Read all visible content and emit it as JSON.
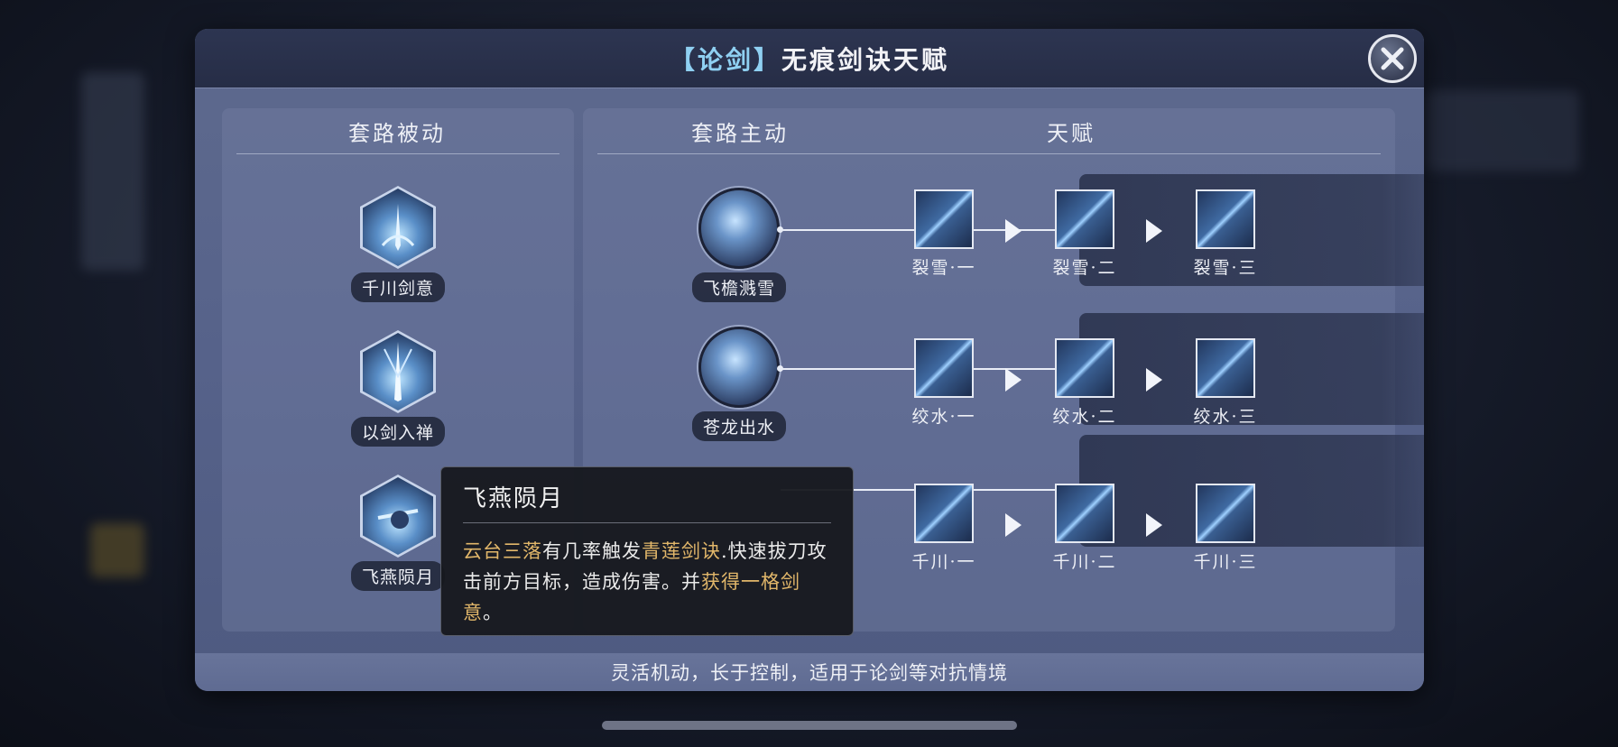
{
  "header": {
    "bracket_open": "【",
    "mode": "论剑",
    "bracket_close": "】",
    "title": "无痕剑诀天赋"
  },
  "left_panel": {
    "heading": "套路被动",
    "skills": [
      {
        "name": "千川剑意"
      },
      {
        "name": "以剑入禅"
      },
      {
        "name": "飞燕陨月"
      }
    ]
  },
  "right_panel": {
    "heading_active": "套路主动",
    "heading_talent": "天赋",
    "rows": [
      {
        "skill": "飞檐溅雪",
        "talents": [
          "裂雪·一",
          "裂雪·二",
          "裂雪·三"
        ]
      },
      {
        "skill": "苍龙出水",
        "talents": [
          "绞水·一",
          "绞水·二",
          "绞水·三"
        ]
      },
      {
        "skill": "",
        "talents": [
          "千川·一",
          "千川·二",
          "千川·三"
        ]
      }
    ]
  },
  "tooltip": {
    "title": "飞燕陨月",
    "seg1": "云台三落",
    "seg2": "有几率触发",
    "seg3": "青莲剑诀",
    "seg4": ".快速拔刀攻击前方目标，造成伤害。并",
    "seg5": "获得一格剑意",
    "seg6": "。"
  },
  "footer": {
    "text": "灵活机动，长于控制，适用于论剑等对抗情境"
  },
  "colors": {
    "highlight": "#e2b76a",
    "title_accent": "#8fd0f2"
  },
  "icons": {
    "close": "close-x-icon"
  }
}
